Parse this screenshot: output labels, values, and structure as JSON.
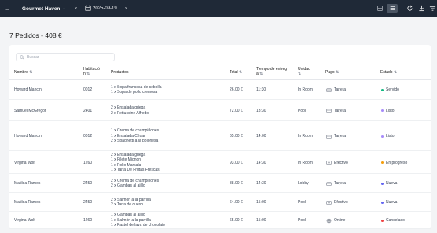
{
  "topbar": {
    "title": "Gourmet Haven",
    "date": "2025-09-19"
  },
  "heading": "7 Pedidos - 408 €",
  "search": {
    "placeholder": "Buscar"
  },
  "columns": {
    "name": "Nombre",
    "room_line1": "Habitació",
    "room_line2": "n",
    "products": "Productos",
    "total": "Total",
    "time_line1": "Tiempo de entreg",
    "time_line2": "a",
    "unit_line1": "Unidad",
    "unit_line2": "",
    "payment": "Pago",
    "status": "Estado"
  },
  "status_colors": {
    "Servido": "#10b981",
    "Listo": "#a78bfa",
    "En progreso": "#f59e0b",
    "Nueva": "#6366f1",
    "Cancelado": "#ef4444"
  },
  "orders": [
    {
      "name": "Howard Mancini",
      "room": "0012",
      "products": [
        "1 x Sopa francesa de cebolla",
        "1 x Sopa de pollo cremosa"
      ],
      "total": "26.00 €",
      "time": "11:30",
      "unit": "In Room",
      "payment": "Tarjeta",
      "payment_icon": "card-icon",
      "status": "Servido"
    },
    {
      "name": "Samuel McGregor",
      "room": "2401",
      "products": [
        "2 x Ensalada griega",
        "2 x Fettuccine Alfredo"
      ],
      "total": "72.00 €",
      "time": "13:30",
      "unit": "Pool",
      "payment": "Tarjeta",
      "payment_icon": "card-icon",
      "status": "Listo"
    },
    {
      "name": "Howard Mancini",
      "room": "0012",
      "products": [
        "1 x Crema de champiñones",
        "1 x Ensalada César",
        "2 x Spaghetti a la boloñesa"
      ],
      "total": "65.00 €",
      "time": "14:00",
      "unit": "In Room",
      "payment": "Tarjeta",
      "payment_icon": "card-icon",
      "status": "Listo"
    },
    {
      "name": "Virgina Wolf",
      "room": "1260",
      "products": [
        "2 x Ensalada griega",
        "1 x Filete Mignon",
        "1 x Pollo Marsala",
        "1 x Tarta De Frutas Frescas"
      ],
      "total": "93.00 €",
      "time": "14:30",
      "unit": "In Room",
      "payment": "Efectivo",
      "payment_icon": "cash-icon",
      "status": "En progreso"
    },
    {
      "name": "Matilda Ramos",
      "room": "2450",
      "products": [
        "2 x Crema de champiñones",
        "2 x Gambas al ajillo"
      ],
      "total": "88.00 €",
      "time": "14:30",
      "unit": "Lobby",
      "payment": "Tarjeta",
      "payment_icon": "card-icon",
      "status": "Nueva"
    },
    {
      "name": "Matilda Ramos",
      "room": "2450",
      "products": [
        "2 x Salmón a la parrilla",
        "2 x Tarta de queso"
      ],
      "total": "64.00 €",
      "time": "15:00",
      "unit": "Pool",
      "payment": "Efectivo",
      "payment_icon": "cash-icon",
      "status": "Nueva"
    },
    {
      "name": "Virgina Wolf",
      "room": "1260",
      "products": [
        "1 x Gambas al ajillo",
        "1 x Salmón a la parrilla",
        "1 x Pastel de lava de chocolate"
      ],
      "total": "65.00 €",
      "time": "15:00",
      "unit": "Pool",
      "payment": "Online",
      "payment_icon": "globe-icon",
      "status": "Cancelado"
    }
  ]
}
